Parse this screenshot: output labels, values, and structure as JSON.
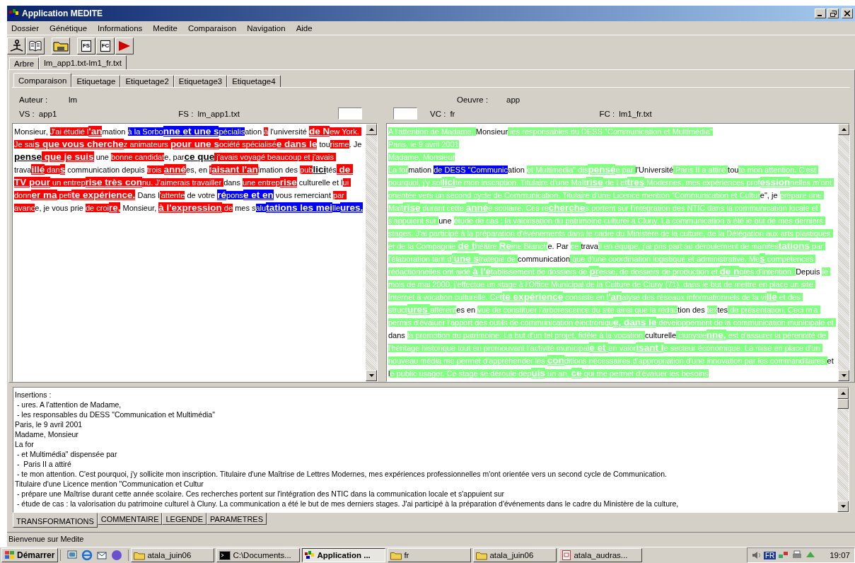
{
  "window": {
    "title": "Application MEDITE"
  },
  "menu": [
    "Dossier",
    "Génétique",
    "Informations",
    "Medite",
    "Comparaison",
    "Navigation",
    "Aide"
  ],
  "toolbar": [
    [
      {
        "kind": "anchor"
      },
      {
        "kind": "book"
      }
    ],
    [
      {
        "kind": "folder"
      }
    ],
    [
      {
        "kind": "doc",
        "label": "FS"
      },
      {
        "kind": "doc",
        "label": "FC"
      },
      {
        "kind": "play"
      }
    ]
  ],
  "outer_tabs": [
    {
      "label": "Arbre",
      "selected": false
    },
    {
      "label": "lm_app1.txt-lm1_fr.txt",
      "selected": true
    }
  ],
  "inner_tabs": [
    {
      "label": "Comparaison",
      "selected": true
    },
    {
      "label": "Etiquetage",
      "selected": false
    },
    {
      "label": "Etiquetage2",
      "selected": false
    },
    {
      "label": "Etiquetage3",
      "selected": false
    },
    {
      "label": "Etiquetage4",
      "selected": false
    }
  ],
  "source": {
    "author": {
      "label": "Auteur :",
      "value": "lm"
    },
    "version": {
      "label": "VS :",
      "value": "app1"
    },
    "file": {
      "label": "FS :",
      "value": "lm_app1.txt"
    }
  },
  "target": {
    "work": {
      "label": "Oeuvre :",
      "value": "app"
    },
    "version": {
      "label": "VC :",
      "value": "fr"
    },
    "file": {
      "label": "FC :",
      "value": "lm1_fr.txt"
    }
  },
  "source_text": [
    {
      "text": "Monsieur, ",
      "kind": "common",
      "emphasized": false
    },
    {
      "text": "J'ai étudié l",
      "kind": "deleted",
      "emphasized": false
    },
    {
      "text": "'an",
      "kind": "deleted",
      "emphasized": true
    },
    {
      "text": "mation ",
      "kind": "common",
      "emphasized": false
    },
    {
      "text": "à la Sorbo",
      "kind": "moved",
      "emphasized": false
    },
    {
      "text": "nne et une s",
      "kind": "moved",
      "emphasized": true
    },
    {
      "text": "pécialis",
      "kind": "moved",
      "emphasized": false
    },
    {
      "text": "ation ",
      "kind": "common",
      "emphasized": false
    },
    {
      "text": "à",
      "kind": "deleted",
      "emphasized": false
    },
    {
      "text": " l'université ",
      "kind": "common",
      "emphasized": false
    },
    {
      "text": "de N",
      "kind": "deleted",
      "emphasized": true
    },
    {
      "text": "ew York. Je sai",
      "kind": "deleted",
      "emphasized": false
    },
    {
      "text": "s que vous cherche",
      "kind": "deleted",
      "emphasized": true
    },
    {
      "text": "z animateurs ",
      "kind": "deleted",
      "emphasized": false
    },
    {
      "text": "pour une s",
      "kind": "deleted",
      "emphasized": true
    },
    {
      "text": "ociété spécialisé",
      "kind": "deleted",
      "emphasized": false
    },
    {
      "text": "e dans le",
      "kind": "deleted",
      "emphasized": true
    },
    {
      "text": " tou",
      "kind": "common",
      "emphasized": false
    },
    {
      "text": "risme",
      "kind": "deleted",
      "emphasized": false
    },
    {
      "text": ". Je ",
      "kind": "common",
      "emphasized": false
    },
    {
      "text": "pense",
      "kind": "common",
      "emphasized": true
    },
    {
      "text": " que je suis",
      "kind": "deleted",
      "emphasized": true
    },
    {
      "text": " une ",
      "kind": "common",
      "emphasized": false
    },
    {
      "text": "bonne candidat",
      "kind": "deleted",
      "emphasized": false
    },
    {
      "text": "e, par",
      "kind": "common",
      "emphasized": false
    },
    {
      "text": "ce que",
      "kind": "common",
      "emphasized": true
    },
    {
      "text": " j'avais voyagé beaucoup et j'avais ",
      "kind": "deleted",
      "emphasized": false
    },
    {
      "text": "trava",
      "kind": "common",
      "emphasized": false
    },
    {
      "text": "illé",
      "kind": "deleted",
      "emphasized": true
    },
    {
      "text": " dan",
      "kind": "deleted",
      "emphasized": false
    },
    {
      "text": "s",
      "kind": "deleted",
      "emphasized": true
    },
    {
      "text": " communication depuis ",
      "kind": "common",
      "emphasized": false
    },
    {
      "text": "trois ",
      "kind": "deleted",
      "emphasized": false
    },
    {
      "text": "anné",
      "kind": "deleted",
      "emphasized": true
    },
    {
      "text": "es, en ",
      "kind": "common",
      "emphasized": false
    },
    {
      "text": "f",
      "kind": "deleted",
      "emphasized": false
    },
    {
      "text": "aisant l'an",
      "kind": "deleted",
      "emphasized": true
    },
    {
      "text": "imation des ",
      "kind": "common",
      "emphasized": false
    },
    {
      "text": "pub",
      "kind": "deleted",
      "emphasized": false
    },
    {
      "text": "lici",
      "kind": "common",
      "emphasized": true
    },
    {
      "text": "tés",
      "kind": "common",
      "emphasized": false
    },
    {
      "text": " de TV pour",
      "kind": "deleted",
      "emphasized": true
    },
    {
      "text": " un entrep",
      "kind": "deleted",
      "emphasized": false
    },
    {
      "text": "rise très con",
      "kind": "deleted",
      "emphasized": true
    },
    {
      "text": "nu. J'aimerais travailler ",
      "kind": "deleted",
      "emphasized": false
    },
    {
      "text": "dans ",
      "kind": "common",
      "emphasized": false
    },
    {
      "text": "une entrep",
      "kind": "deleted",
      "emphasized": false
    },
    {
      "text": "rise",
      "kind": "deleted",
      "emphasized": true
    },
    {
      "text": " culturelle et l",
      "kind": "common",
      "emphasized": false
    },
    {
      "text": "ui donn",
      "kind": "deleted",
      "emphasized": false
    },
    {
      "text": "er ma",
      "kind": "deleted",
      "emphasized": true
    },
    {
      "text": " peti",
      "kind": "deleted",
      "emphasized": false
    },
    {
      "text": "te expérience.",
      "kind": "deleted",
      "emphasized": true
    },
    {
      "text": " Dans l",
      "kind": "common",
      "emphasized": false
    },
    {
      "text": "'attente",
      "kind": "deleted",
      "emphasized": false
    },
    {
      "text": " de votre ",
      "kind": "common",
      "emphasized": false
    },
    {
      "text": "ré",
      "kind": "moved",
      "emphasized": true
    },
    {
      "text": "pons",
      "kind": "moved",
      "emphasized": false
    },
    {
      "text": "e et en",
      "kind": "moved",
      "emphasized": true
    },
    {
      "text": " vous remerciant ",
      "kind": "common",
      "emphasized": false
    },
    {
      "text": "par avanc",
      "kind": "deleted",
      "emphasized": false
    },
    {
      "text": "e, je vous prie ",
      "kind": "common",
      "emphasized": false
    },
    {
      "text": "de croi",
      "kind": "deleted",
      "emphasized": false
    },
    {
      "text": "re,",
      "kind": "deleted",
      "emphasized": true
    },
    {
      "text": " Monsieur, ",
      "kind": "common",
      "emphasized": false
    },
    {
      "text": "à l'expression",
      "kind": "deleted",
      "emphasized": true
    },
    {
      "text": " de",
      "kind": "deleted",
      "emphasized": false
    },
    {
      "text": " mes s",
      "kind": "common",
      "emphasized": false
    },
    {
      "text": "alu",
      "kind": "moved",
      "emphasized": false
    },
    {
      "text": "tations les mei",
      "kind": "moved",
      "emphasized": true
    },
    {
      "text": "lle",
      "kind": "moved",
      "emphasized": false
    },
    {
      "text": "ures.",
      "kind": "moved",
      "emphasized": true
    }
  ],
  "target_text": [
    {
      "text": "A l'attention de Madame, ",
      "kind": "inserted",
      "emphasized": false
    },
    {
      "text": "Monsieur",
      "kind": "common",
      "emphasized": false
    },
    {
      "text": " les responsables du DESS \"Communication et Multimédia\"\nParis, le 9 avril 2001\nMadame, Monsieur\nLa for",
      "kind": "inserted",
      "emphasized": false
    },
    {
      "text": "mation ",
      "kind": "common",
      "emphasized": false
    },
    {
      "text": "de DESS \"Communic",
      "kind": "moved",
      "emphasized": false
    },
    {
      "text": "ation ",
      "kind": "common",
      "emphasized": false
    },
    {
      "text": "et Multimédia\" dis",
      "kind": "inserted",
      "emphasized": false
    },
    {
      "text": "pensé",
      "kind": "inserted",
      "emphasized": true
    },
    {
      "text": "e par ",
      "kind": "inserted",
      "emphasized": false
    },
    {
      "text": "l'Université",
      "kind": "common",
      "emphasized": false
    },
    {
      "text": " Paris II a attiré ",
      "kind": "inserted",
      "emphasized": false
    },
    {
      "text": "tou",
      "kind": "common",
      "emphasized": false
    },
    {
      "text": "te mon attention. C'est pourquoi, j'y sol",
      "kind": "inserted",
      "emphasized": false
    },
    {
      "text": "lici",
      "kind": "inserted",
      "emphasized": true
    },
    {
      "text": "te mon inscription. Titulaire d'une Maît",
      "kind": "inserted",
      "emphasized": false
    },
    {
      "text": "rise",
      "kind": "inserted",
      "emphasized": true
    },
    {
      "text": " de Let",
      "kind": "inserted",
      "emphasized": false
    },
    {
      "text": "tres",
      "kind": "inserted",
      "emphasized": true
    },
    {
      "text": " Modernes, mes expériences prof",
      "kind": "inserted",
      "emphasized": false
    },
    {
      "text": "ession",
      "kind": "inserted",
      "emphasized": true
    },
    {
      "text": "nelles m'ont orientée vers un second cycle de Communication. Titulaire d'une Licence mention \"Communication et Cultur",
      "kind": "inserted",
      "emphasized": false
    },
    {
      "text": "e\", je ",
      "kind": "common",
      "emphasized": false
    },
    {
      "text": "prépare une Maît",
      "kind": "inserted",
      "emphasized": false
    },
    {
      "text": "rise",
      "kind": "inserted",
      "emphasized": true
    },
    {
      "text": " durant cette ",
      "kind": "inserted",
      "emphasized": false
    },
    {
      "text": "anné",
      "kind": "inserted",
      "emphasized": true
    },
    {
      "text": "e scolaire. Ces re",
      "kind": "inserted",
      "emphasized": false
    },
    {
      "text": "cherche",
      "kind": "inserted",
      "emphasized": true
    },
    {
      "text": "s portent sur l'intégration des NTIC dans la communication locale et s'appuient sur ",
      "kind": "inserted",
      "emphasized": false
    },
    {
      "text": "une ",
      "kind": "common",
      "emphasized": false
    },
    {
      "text": "étude de cas : la valorisation du patrimoine culturel à Cluny. La communication a été le but de mes derniers stages. J'ai participé à la préparation d'événements dans le cadre du Ministère de la culture, de la Délégation aux arts plastiques et de la Compagnie ",
      "kind": "inserted",
      "emphasized": false
    },
    {
      "text": "de t",
      "kind": "inserted",
      "emphasized": true
    },
    {
      "text": "héâtre ",
      "kind": "inserted",
      "emphasized": false
    },
    {
      "text": "Re",
      "kind": "inserted",
      "emphasized": true
    },
    {
      "text": "ine Blanch",
      "kind": "inserted",
      "emphasized": false
    },
    {
      "text": "e. Par ",
      "kind": "common",
      "emphasized": false
    },
    {
      "text": "ce ",
      "kind": "inserted",
      "emphasized": false
    },
    {
      "text": "trava",
      "kind": "common",
      "emphasized": false
    },
    {
      "text": "il en équipe, j'ai pris part au déroulement de manifes",
      "kind": "inserted",
      "emphasized": false
    },
    {
      "text": "tations",
      "kind": "inserted",
      "emphasized": true
    },
    {
      "text": " par l'élaboration tant d",
      "kind": "inserted",
      "emphasized": false
    },
    {
      "text": "'une s",
      "kind": "inserted",
      "emphasized": true
    },
    {
      "text": "tratégie de ",
      "kind": "inserted",
      "emphasized": false
    },
    {
      "text": "communication",
      "kind": "common",
      "emphasized": false
    },
    {
      "text": " que d'une coordination logistique et administrative. Me",
      "kind": "inserted",
      "emphasized": false
    },
    {
      "text": "s",
      "kind": "inserted",
      "emphasized": true
    },
    {
      "text": " compétences rédactionnelles ont aidé ",
      "kind": "inserted",
      "emphasized": false
    },
    {
      "text": "à l'é",
      "kind": "inserted",
      "emphasized": true
    },
    {
      "text": "tablissement de dossiers de ",
      "kind": "inserted",
      "emphasized": false
    },
    {
      "text": "pr",
      "kind": "inserted",
      "emphasized": true
    },
    {
      "text": "esse, de dossiers de production et ",
      "kind": "inserted",
      "emphasized": false
    },
    {
      "text": "de n",
      "kind": "inserted",
      "emphasized": true
    },
    {
      "text": "otes d'intention. ",
      "kind": "inserted",
      "emphasized": false
    },
    {
      "text": "Depuis ",
      "kind": "common",
      "emphasized": false
    },
    {
      "text": "le mois de mai 2000, j'effectue un stage à l'Office Municipal de la Culture de Cluny (71), dans le but de mettre en place un site Internet à vocation culturelle. Cet",
      "kind": "inserted",
      "emphasized": false
    },
    {
      "text": "te expérience",
      "kind": "inserted",
      "emphasized": true
    },
    {
      "text": " consiste en l",
      "kind": "inserted",
      "emphasized": false
    },
    {
      "text": "'an",
      "kind": "inserted",
      "emphasized": true
    },
    {
      "text": "alyse des réseaux informationnels de la vi",
      "kind": "inserted",
      "emphasized": false
    },
    {
      "text": "lle",
      "kind": "inserted",
      "emphasized": true
    },
    {
      "text": " et des struct",
      "kind": "inserted",
      "emphasized": false
    },
    {
      "text": "ures ",
      "kind": "inserted",
      "emphasized": true
    },
    {
      "text": "afférent",
      "kind": "inserted",
      "emphasized": false
    },
    {
      "text": "es en ",
      "kind": "common",
      "emphasized": false
    },
    {
      "text": "vue de constituer l'arborescence du site ainsi que la rédac",
      "kind": "inserted",
      "emphasized": false
    },
    {
      "text": "tion des ",
      "kind": "common",
      "emphasized": false
    },
    {
      "text": "tex",
      "kind": "inserted",
      "emphasized": false
    },
    {
      "text": "tes",
      "kind": "common",
      "emphasized": false
    },
    {
      "text": " de présentation. Ceci m'a permis d'évaluer l'apport des outils de communication électroniqu",
      "kind": "inserted",
      "emphasized": false
    },
    {
      "text": "e, dans le",
      "kind": "inserted",
      "emphasized": true
    },
    {
      "text": " développement de la communication municipale et ",
      "kind": "inserted",
      "emphasized": false
    },
    {
      "text": "dans ",
      "kind": "common",
      "emphasized": false
    },
    {
      "text": "la promotion du patrimoine. La but d'un tel projet, fidèle à la vocation ",
      "kind": "inserted",
      "emphasized": false
    },
    {
      "text": "culturelle",
      "kind": "common",
      "emphasized": false
    },
    {
      "text": " clunysie",
      "kind": "inserted",
      "emphasized": false
    },
    {
      "text": "nne,",
      "kind": "inserted",
      "emphasized": true
    },
    {
      "text": " est d'assurer la pérennité de l'héritage historique tout en promouvant l'activité municipal",
      "kind": "inserted",
      "emphasized": false
    },
    {
      "text": "e et ",
      "kind": "inserted",
      "emphasized": true
    },
    {
      "text": "en valor",
      "kind": "inserted",
      "emphasized": false
    },
    {
      "text": "isant l",
      "kind": "inserted",
      "emphasized": true
    },
    {
      "text": "e secteur économique. La mise en place d'un nouveau média me permet d'appréhender les ",
      "kind": "inserted",
      "emphasized": false
    },
    {
      "text": "con",
      "kind": "inserted",
      "emphasized": true
    },
    {
      "text": "ditions nécessaires d'appropriation d'une innovation par les commanditaires ",
      "kind": "inserted",
      "emphasized": false
    },
    {
      "text": "et l",
      "kind": "common",
      "emphasized": false
    },
    {
      "text": "e public usager. Ce stage se déroule dep",
      "kind": "inserted",
      "emphasized": false
    },
    {
      "text": "uis",
      "kind": "inserted",
      "emphasized": true
    },
    {
      "text": " un an, ",
      "kind": "inserted",
      "emphasized": false
    },
    {
      "text": "ce",
      "kind": "inserted",
      "emphasized": true
    },
    {
      "text": " qui me permet d'évaluer les besoins",
      "kind": "inserted",
      "emphasized": false
    }
  ],
  "insertions": [
    "Insertions :",
    " - ures. A l'attention de Madame,",
    " - les responsables du DESS \"Communication et Multimédia\"",
    "Paris, le 9 avril 2001",
    "Madame, Monsieur",
    "La for",
    " - et Multimédia\" dispensée par",
    " -  Paris II a attiré",
    " - te mon attention. C'est pourquoi, j'y sollicite mon inscription. Titulaire d'une Maîtrise de Lettres Modernes, mes expériences professionnelles m'ont orientée vers un second cycle de Communication.",
    "Titulaire d'une Licence mention \"Communication et Cultur",
    " - prépare une Maîtrise durant cette année scolaire. Ces recherches portent sur l'intégration des NTIC dans la communication locale et s'appuient sur",
    " - étude de cas : la valorisation du patrimoine culturel à Cluny. La communication a été le but de mes derniers stages. J'ai participé à la préparation d'événements dans le cadre du Ministère de la culture,"
  ],
  "bottom_tabs": [
    {
      "label": "TRANSFORMATIONS",
      "selected": true
    },
    {
      "label": "COMMENTAIRE",
      "selected": false
    },
    {
      "label": "LEGENDE",
      "selected": false
    },
    {
      "label": "PARAMETRES",
      "selected": false
    }
  ],
  "status_bar": "Bienvenue sur Medite",
  "taskbar": {
    "start": "Démarrer",
    "tasks": [
      {
        "label": "atala_juin06",
        "kind": "folder",
        "selected": false
      },
      {
        "label": "C:\\Documents...",
        "kind": "console",
        "selected": false
      },
      {
        "label": "Application ...",
        "kind": "app",
        "selected": true
      },
      {
        "label": "fr",
        "kind": "folder",
        "selected": false
      },
      {
        "label": "atala_juin06",
        "kind": "folder",
        "selected": false
      },
      {
        "label": "atala_audras...",
        "kind": "document",
        "selected": false
      }
    ],
    "language": "FR",
    "time": "19:07"
  }
}
